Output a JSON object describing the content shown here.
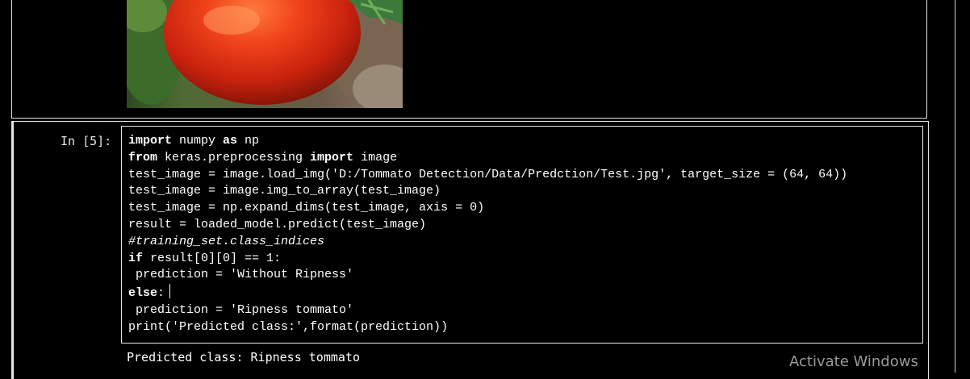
{
  "previous_output": {
    "image_alt": "tomato"
  },
  "cell": {
    "prompt": "In [5]:",
    "code_lines": [
      [
        {
          "t": "import",
          "k": "kw"
        },
        {
          "t": " numpy "
        },
        {
          "t": "as",
          "k": "kw"
        },
        {
          "t": " np"
        }
      ],
      [
        {
          "t": "from",
          "k": "kw"
        },
        {
          "t": " keras.preprocessing "
        },
        {
          "t": "import",
          "k": "kw"
        },
        {
          "t": " image"
        }
      ],
      [
        {
          "t": "test_image = image.load_img('D:/Tommato Detection/Data/Predction/Test.jpg', target_size = (64, 64))"
        }
      ],
      [
        {
          "t": "test_image = image.img_to_array(test_image)"
        }
      ],
      [
        {
          "t": "test_image = np.expand_dims(test_image, axis = 0)"
        }
      ],
      [
        {
          "t": "result = loaded_model.predict(test_image)"
        }
      ],
      [
        {
          "t": "#training_set.class_indices",
          "k": "cm"
        }
      ],
      [
        {
          "t": "if",
          "k": "kw"
        },
        {
          "t": " result[0][0] == 1:"
        }
      ],
      [
        {
          "t": " prediction = 'Without Ripness'"
        }
      ],
      [
        {
          "t": "else",
          "k": "kw"
        },
        {
          "t": ":"
        },
        {
          "t": "",
          "k": "cursor"
        }
      ],
      [
        {
          "t": " prediction = 'Ripness tommato'"
        }
      ],
      [
        {
          "t": "print('Predicted class:',format(prediction))"
        }
      ]
    ],
    "output": "Predicted class: Ripness tommato"
  },
  "watermark": "Activate Windows"
}
